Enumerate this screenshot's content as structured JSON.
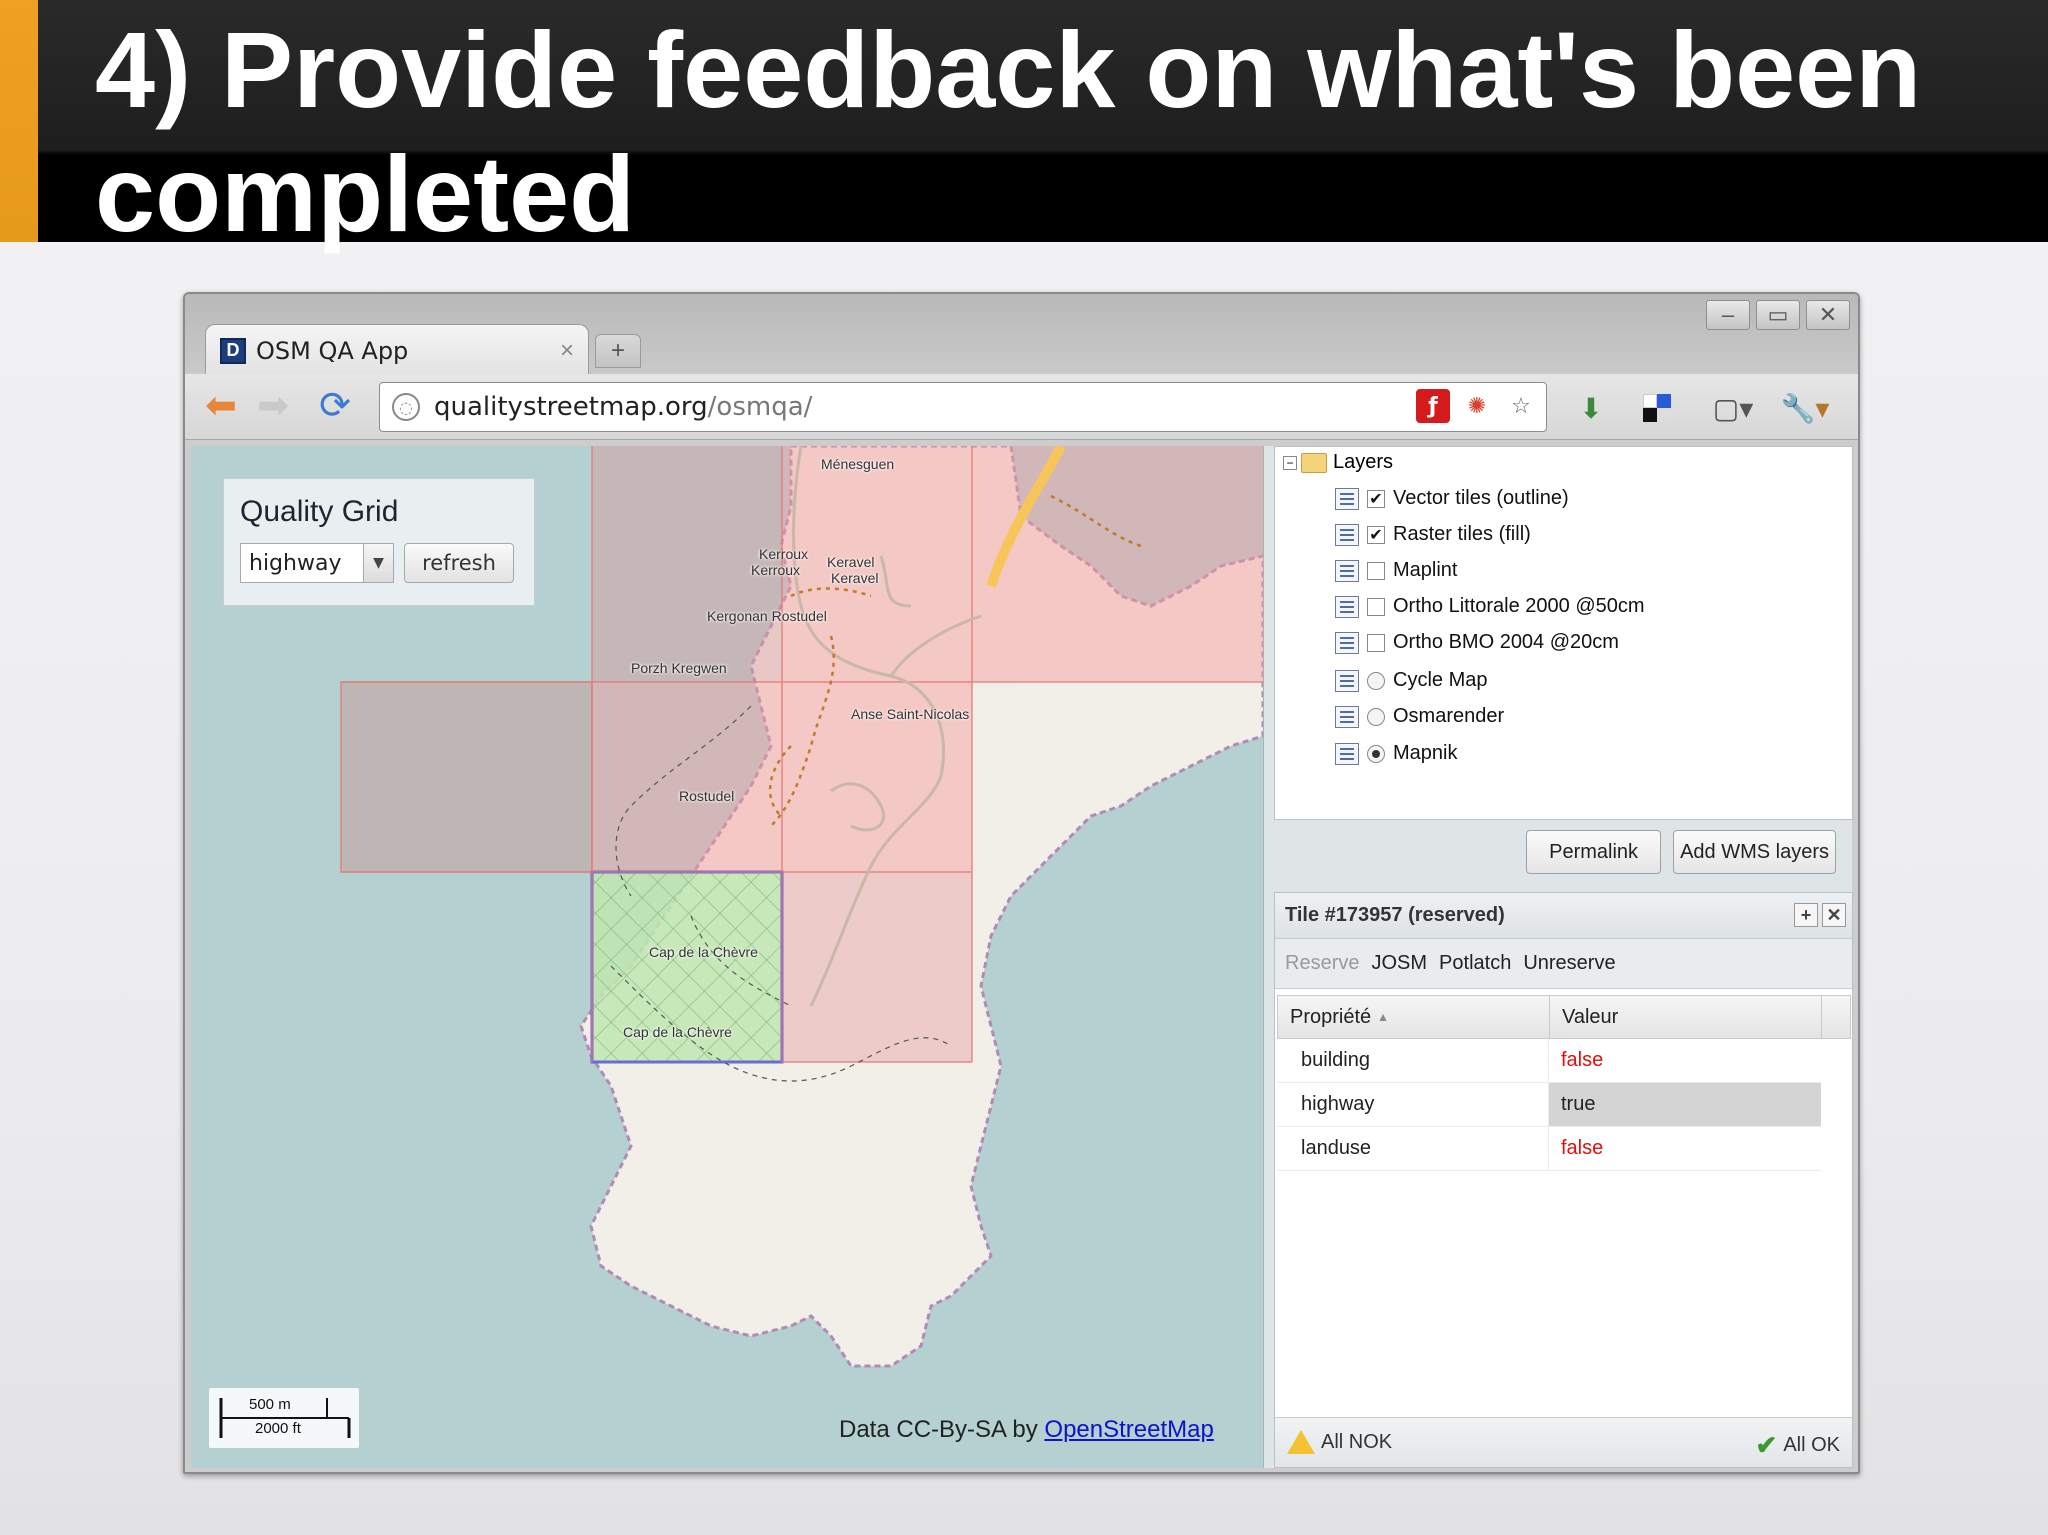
{
  "slide": {
    "title": "4) Provide feedback on what's been completed",
    "colors": {
      "accent": "#f0a022",
      "header_bg": "#000000"
    }
  },
  "browser": {
    "tab_title": "OSM QA App",
    "tab_favicon": "D",
    "url_domain": "qualitystreetmap.org",
    "url_path": "/osmqa/",
    "icons": [
      "back-arrow-icon",
      "forward-arrow-icon",
      "reload-icon",
      "globe-icon",
      "pdf-icon",
      "firebug-icon",
      "star-icon",
      "extension-icon",
      "delicious-icon",
      "page-menu-icon",
      "wrench-icon"
    ]
  },
  "map": {
    "quality_grid": {
      "title": "Quality Grid",
      "selected": "highway",
      "refresh_label": "refresh"
    },
    "scale": {
      "top": "500 m",
      "bottom": "2000 ft"
    },
    "attribution": {
      "prefix": "Data CC-By-SA by",
      "link": "OpenStreetMap"
    },
    "labels": {
      "menesguen": "Ménesguen",
      "kerroux1": "Kerroux",
      "kerroux2": "Kerroux",
      "keravel1": "Keravel",
      "keravel2": "Keravel",
      "kergonan": "Kergonan Rostudel",
      "porzh": "Porzh Kregwen",
      "anse": "Anse Saint-Nicolas",
      "rostudel": "Rostudel",
      "cap1": "Cap de la Chèvre",
      "cap2": "Cap de la Chèvre"
    }
  },
  "layers": {
    "root": "Layers",
    "items": [
      {
        "label": "Vector tiles (outline)",
        "type": "checkbox",
        "checked": true
      },
      {
        "label": "Raster tiles (fill)",
        "type": "checkbox",
        "checked": true
      },
      {
        "label": "Maplint",
        "type": "checkbox",
        "checked": false
      },
      {
        "label": "Ortho Littorale 2000 @50cm",
        "type": "checkbox",
        "checked": false
      },
      {
        "label": "Ortho BMO 2004 @20cm",
        "type": "checkbox",
        "checked": false
      },
      {
        "label": "Cycle Map",
        "type": "radio",
        "checked": false
      },
      {
        "label": "Osmarender",
        "type": "radio",
        "checked": false
      },
      {
        "label": "Mapnik",
        "type": "radio",
        "checked": true
      }
    ],
    "permalink_label": "Permalink",
    "add_wms_label": "Add WMS layers"
  },
  "tile": {
    "title": "Tile #173957 (reserved)",
    "actions": {
      "reserve": "Reserve",
      "josm": "JOSM",
      "potlatch": "Potlatch",
      "unreserve": "Unreserve"
    },
    "columns": {
      "key": "Propriété",
      "sort_indicator": "▲",
      "value": "Valeur"
    },
    "rows": [
      {
        "key": "building",
        "value": "false"
      },
      {
        "key": "highway",
        "value": "true"
      },
      {
        "key": "landuse",
        "value": "false"
      }
    ],
    "colors": {
      "false": "#e01010",
      "true": "#222222",
      "selected_row": "#d4d4d4"
    },
    "footer": {
      "all_nok": "All NOK",
      "all_ok": "All OK"
    }
  }
}
